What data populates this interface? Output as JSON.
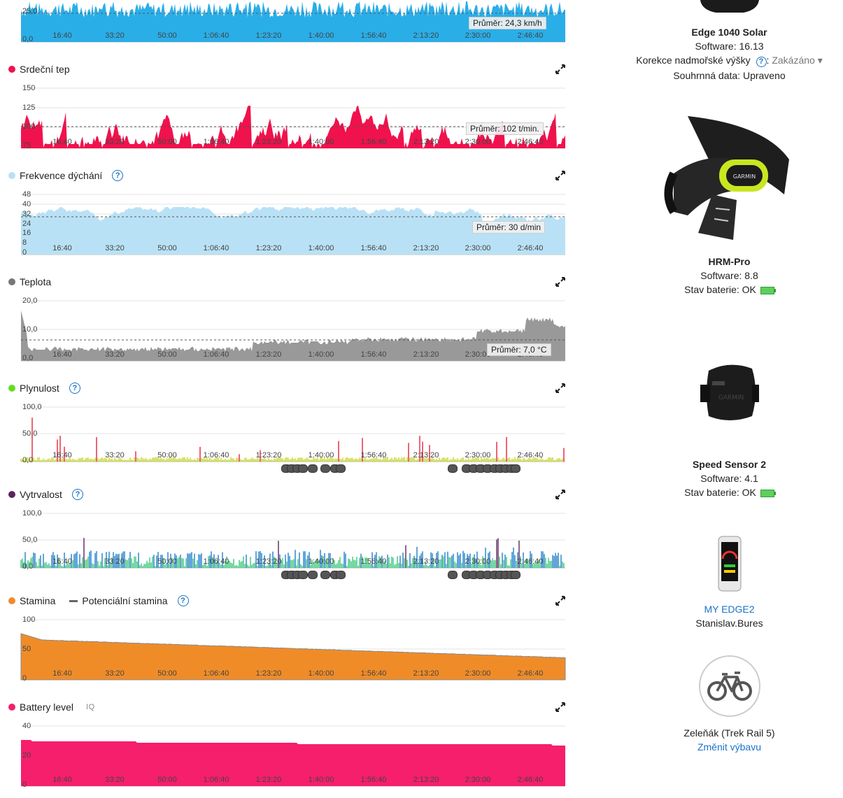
{
  "x_ticks": [
    "16:40",
    "33:20",
    "50:00",
    "1:06:40",
    "1:23:20",
    "1:40:00",
    "1:56:40",
    "2:13:20",
    "2:30:00",
    "2:46:40"
  ],
  "speed": {
    "y_ticks": [
      "25,0",
      "0,0"
    ],
    "avg": "Průměr: 24,3 km/h",
    "color": "#2aaee8"
  },
  "heart": {
    "title": "Srdeční tep",
    "y_ticks": [
      "150",
      "125",
      "100",
      "75"
    ],
    "avg": "Průměr: 102 t/min.",
    "color": "#f0124c"
  },
  "breath": {
    "title": "Frekvence dýchání",
    "y_ticks": [
      "48",
      "40",
      "32",
      "24",
      "16",
      "8",
      "0"
    ],
    "avg": "Průměr: 30 d/min",
    "color": "#b9e1f5"
  },
  "temp": {
    "title": "Teplota",
    "y_ticks": [
      "20,0",
      "10,0",
      "0,0"
    ],
    "avg": "Průměr: 7,0 °C",
    "color": "#999999"
  },
  "flow": {
    "title": "Plynulost",
    "y_ticks": [
      "100,0",
      "50,0",
      "0,0"
    ],
    "color": "#66cc22"
  },
  "grit": {
    "title": "Vytrvalost",
    "y_ticks": [
      "100,0",
      "50,0",
      "0,0"
    ],
    "color": "#5b2460"
  },
  "stamina": {
    "title": "Stamina",
    "title2": "Potenciální stamina",
    "y_ticks": [
      "100",
      "50",
      "0"
    ],
    "color": "#f08c28"
  },
  "battery": {
    "title": "Battery level",
    "iq": "IQ",
    "y_ticks": [
      "40",
      "20",
      "0"
    ],
    "color": "#f51f6c"
  },
  "help_glyph": "?",
  "devices": {
    "edge": {
      "name": "Edge 1040 Solar",
      "software": "Software: 16.13",
      "altitude_label": "Korekce nadmořské výšky",
      "altitude_value": "Zakázáno ▾",
      "summary": "Souhrnná data: Upraveno"
    },
    "hrm": {
      "name": "HRM-Pro",
      "software": "Software: 8.8",
      "battery": "Stav baterie: OK",
      "brand": "GARMIN"
    },
    "speed": {
      "name": "Speed Sensor 2",
      "software": "Software: 4.1",
      "battery": "Stav baterie: OK",
      "brand": "GARMIN"
    },
    "phone": {
      "name": "MY EDGE2",
      "user": "Stanislav.Bures"
    },
    "bike": {
      "name": "Zeleňák (Trek Rail 5)",
      "change": "Změnit výbavu"
    }
  }
}
